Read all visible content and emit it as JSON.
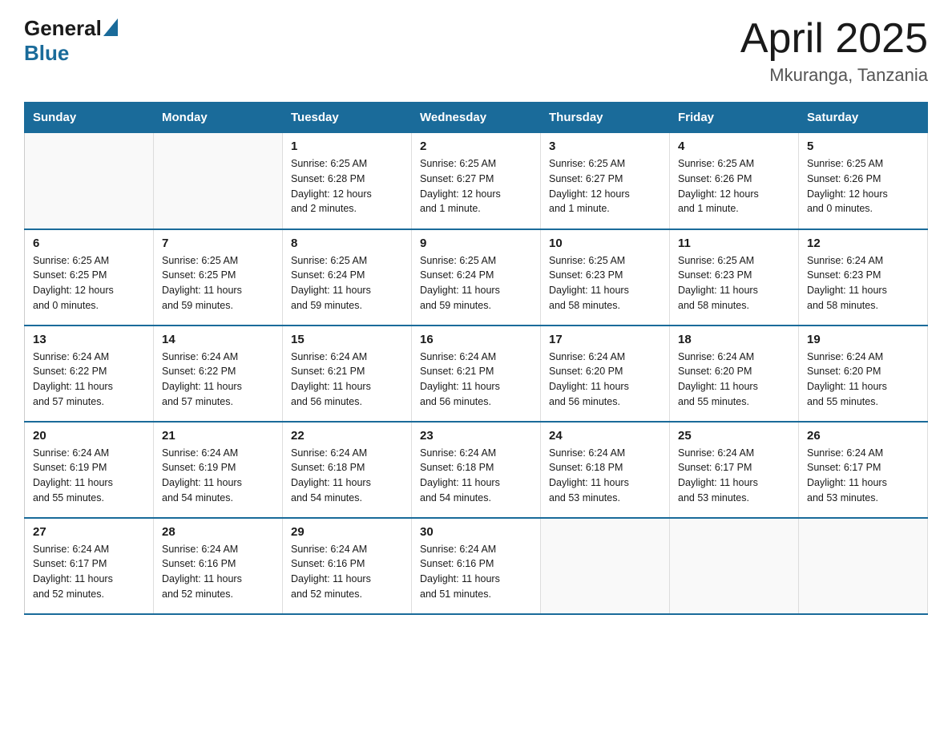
{
  "logo": {
    "general": "General",
    "blue": "Blue"
  },
  "title": {
    "month_year": "April 2025",
    "location": "Mkuranga, Tanzania"
  },
  "header_days": [
    "Sunday",
    "Monday",
    "Tuesday",
    "Wednesday",
    "Thursday",
    "Friday",
    "Saturday"
  ],
  "weeks": [
    [
      {
        "day": "",
        "info": ""
      },
      {
        "day": "",
        "info": ""
      },
      {
        "day": "1",
        "info": "Sunrise: 6:25 AM\nSunset: 6:28 PM\nDaylight: 12 hours\nand 2 minutes."
      },
      {
        "day": "2",
        "info": "Sunrise: 6:25 AM\nSunset: 6:27 PM\nDaylight: 12 hours\nand 1 minute."
      },
      {
        "day": "3",
        "info": "Sunrise: 6:25 AM\nSunset: 6:27 PM\nDaylight: 12 hours\nand 1 minute."
      },
      {
        "day": "4",
        "info": "Sunrise: 6:25 AM\nSunset: 6:26 PM\nDaylight: 12 hours\nand 1 minute."
      },
      {
        "day": "5",
        "info": "Sunrise: 6:25 AM\nSunset: 6:26 PM\nDaylight: 12 hours\nand 0 minutes."
      }
    ],
    [
      {
        "day": "6",
        "info": "Sunrise: 6:25 AM\nSunset: 6:25 PM\nDaylight: 12 hours\nand 0 minutes."
      },
      {
        "day": "7",
        "info": "Sunrise: 6:25 AM\nSunset: 6:25 PM\nDaylight: 11 hours\nand 59 minutes."
      },
      {
        "day": "8",
        "info": "Sunrise: 6:25 AM\nSunset: 6:24 PM\nDaylight: 11 hours\nand 59 minutes."
      },
      {
        "day": "9",
        "info": "Sunrise: 6:25 AM\nSunset: 6:24 PM\nDaylight: 11 hours\nand 59 minutes."
      },
      {
        "day": "10",
        "info": "Sunrise: 6:25 AM\nSunset: 6:23 PM\nDaylight: 11 hours\nand 58 minutes."
      },
      {
        "day": "11",
        "info": "Sunrise: 6:25 AM\nSunset: 6:23 PM\nDaylight: 11 hours\nand 58 minutes."
      },
      {
        "day": "12",
        "info": "Sunrise: 6:24 AM\nSunset: 6:23 PM\nDaylight: 11 hours\nand 58 minutes."
      }
    ],
    [
      {
        "day": "13",
        "info": "Sunrise: 6:24 AM\nSunset: 6:22 PM\nDaylight: 11 hours\nand 57 minutes."
      },
      {
        "day": "14",
        "info": "Sunrise: 6:24 AM\nSunset: 6:22 PM\nDaylight: 11 hours\nand 57 minutes."
      },
      {
        "day": "15",
        "info": "Sunrise: 6:24 AM\nSunset: 6:21 PM\nDaylight: 11 hours\nand 56 minutes."
      },
      {
        "day": "16",
        "info": "Sunrise: 6:24 AM\nSunset: 6:21 PM\nDaylight: 11 hours\nand 56 minutes."
      },
      {
        "day": "17",
        "info": "Sunrise: 6:24 AM\nSunset: 6:20 PM\nDaylight: 11 hours\nand 56 minutes."
      },
      {
        "day": "18",
        "info": "Sunrise: 6:24 AM\nSunset: 6:20 PM\nDaylight: 11 hours\nand 55 minutes."
      },
      {
        "day": "19",
        "info": "Sunrise: 6:24 AM\nSunset: 6:20 PM\nDaylight: 11 hours\nand 55 minutes."
      }
    ],
    [
      {
        "day": "20",
        "info": "Sunrise: 6:24 AM\nSunset: 6:19 PM\nDaylight: 11 hours\nand 55 minutes."
      },
      {
        "day": "21",
        "info": "Sunrise: 6:24 AM\nSunset: 6:19 PM\nDaylight: 11 hours\nand 54 minutes."
      },
      {
        "day": "22",
        "info": "Sunrise: 6:24 AM\nSunset: 6:18 PM\nDaylight: 11 hours\nand 54 minutes."
      },
      {
        "day": "23",
        "info": "Sunrise: 6:24 AM\nSunset: 6:18 PM\nDaylight: 11 hours\nand 54 minutes."
      },
      {
        "day": "24",
        "info": "Sunrise: 6:24 AM\nSunset: 6:18 PM\nDaylight: 11 hours\nand 53 minutes."
      },
      {
        "day": "25",
        "info": "Sunrise: 6:24 AM\nSunset: 6:17 PM\nDaylight: 11 hours\nand 53 minutes."
      },
      {
        "day": "26",
        "info": "Sunrise: 6:24 AM\nSunset: 6:17 PM\nDaylight: 11 hours\nand 53 minutes."
      }
    ],
    [
      {
        "day": "27",
        "info": "Sunrise: 6:24 AM\nSunset: 6:17 PM\nDaylight: 11 hours\nand 52 minutes."
      },
      {
        "day": "28",
        "info": "Sunrise: 6:24 AM\nSunset: 6:16 PM\nDaylight: 11 hours\nand 52 minutes."
      },
      {
        "day": "29",
        "info": "Sunrise: 6:24 AM\nSunset: 6:16 PM\nDaylight: 11 hours\nand 52 minutes."
      },
      {
        "day": "30",
        "info": "Sunrise: 6:24 AM\nSunset: 6:16 PM\nDaylight: 11 hours\nand 51 minutes."
      },
      {
        "day": "",
        "info": ""
      },
      {
        "day": "",
        "info": ""
      },
      {
        "day": "",
        "info": ""
      }
    ]
  ]
}
